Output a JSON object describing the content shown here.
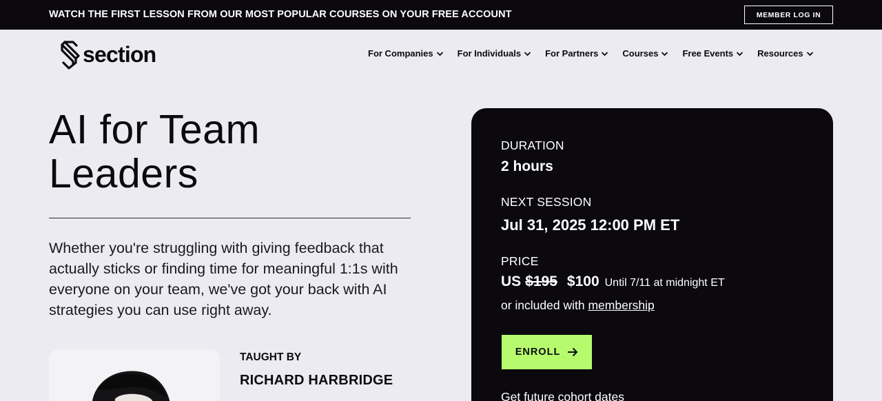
{
  "topbar": {
    "message": "WATCH THE FIRST LESSON FROM OUR MOST POPULAR COURSES ON YOUR FREE ACCOUNT",
    "member_login_label": "MEMBER LOG IN"
  },
  "header": {
    "logo_text": "section",
    "logo_icon": "section-s-logo-icon",
    "nav": [
      {
        "label": "For Companies"
      },
      {
        "label": "For Individuals"
      },
      {
        "label": "For Partners"
      },
      {
        "label": "Courses"
      },
      {
        "label": "Free Events"
      },
      {
        "label": "Resources"
      }
    ]
  },
  "hero": {
    "title": "AI for Team Leaders",
    "description": "Whether you're struggling with giving feedback that actually sticks or finding time for meaningful 1:1s with everyone on your team, we've got your back with AI strategies you can use right away.",
    "taught_by_label": "TAUGHT BY",
    "instructor_name": "RICHARD HARBRIDGE"
  },
  "course_card": {
    "duration_label": "DURATION",
    "duration_value": "2 hours",
    "next_session_label": "NEXT SESSION",
    "next_session_value": "Jul 31, 2025 12:00 PM ET",
    "price_label": "PRICE",
    "price_currency": "US",
    "price_original": "$195",
    "price_sale": "$100",
    "price_note": "Until 7/11 at midnight ET",
    "included_prefix": "or included with",
    "membership_link": "membership",
    "enroll_label": "ENROLL",
    "future_dates_label": "Get future cohort dates"
  },
  "colors": {
    "background": "#ecebf1",
    "dark": "#0b090e",
    "accent_green": "#b6fb6e",
    "white": "#ffffff"
  }
}
